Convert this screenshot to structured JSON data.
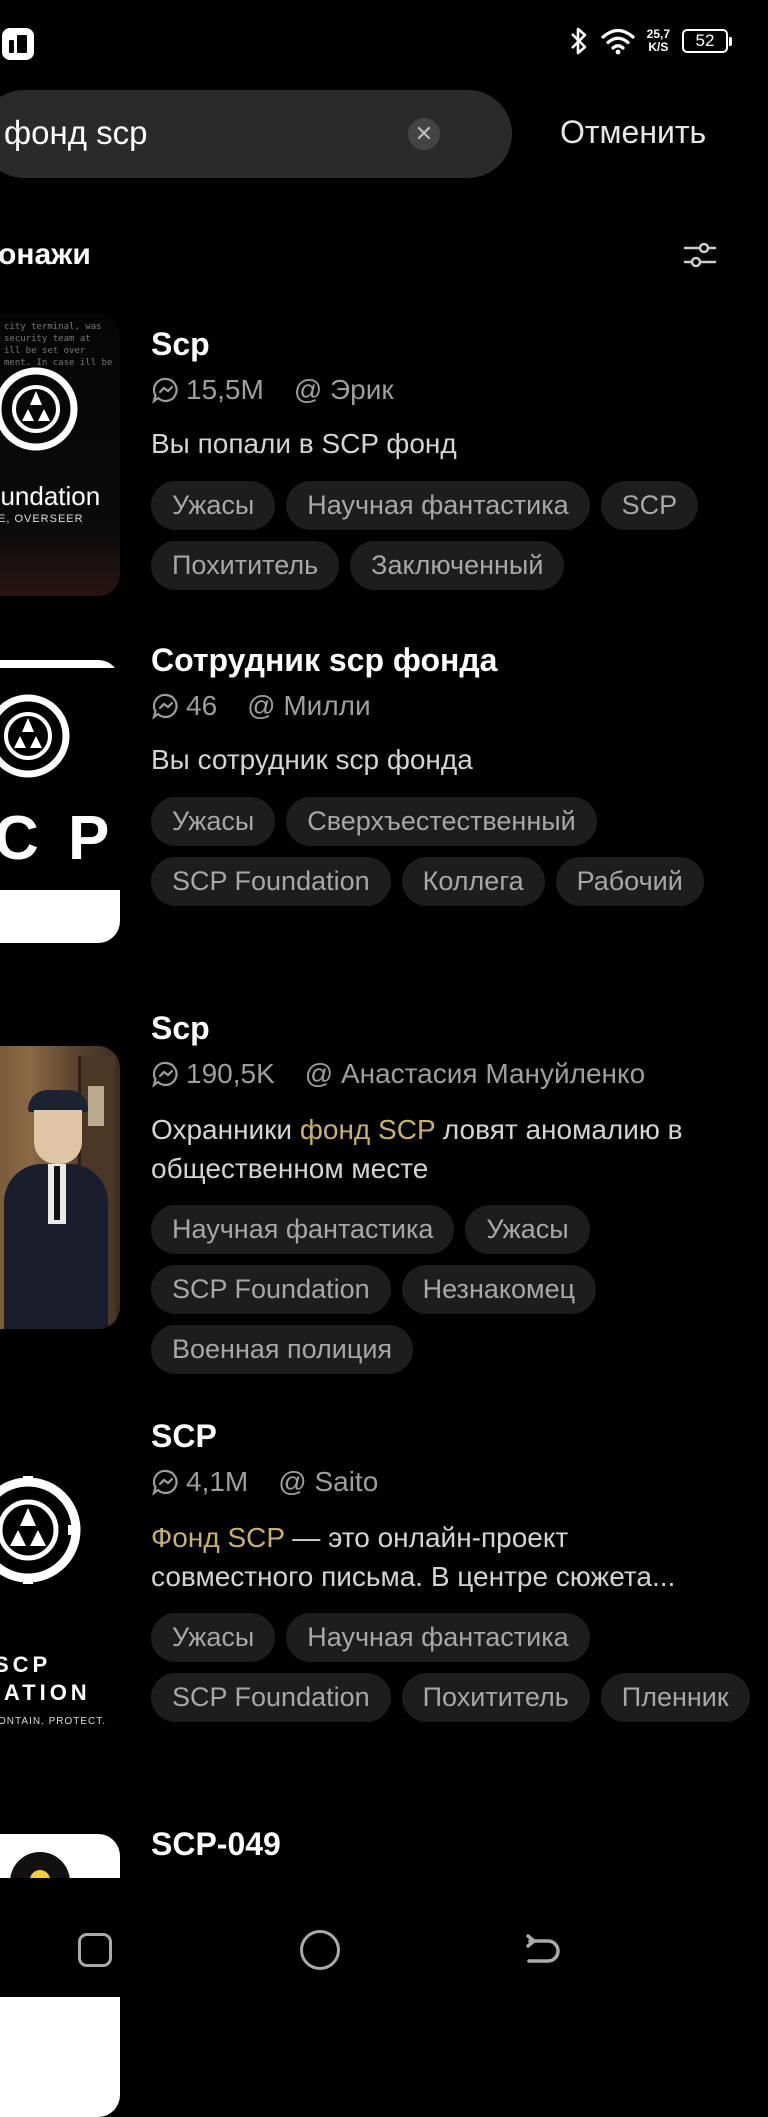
{
  "status_bar": {
    "net_speed_value": "25,7",
    "net_speed_unit": "K/S",
    "battery": "52"
  },
  "search": {
    "query": "фонд scp",
    "cancel_label": "Отменить"
  },
  "section": {
    "title": "онажи"
  },
  "results": [
    {
      "title": "Scp",
      "chats": "15,5M",
      "author": "@ Эрик",
      "description": "Вы попали в SCP фонд",
      "tags": [
        "Ужасы",
        "Научная фантастика",
        "SCP",
        "Похититель",
        "Заключенный"
      ],
      "thumb_text": [
        "oundation",
        "E, OVERSEER"
      ]
    },
    {
      "title": "Сотрудник scp фонда",
      "chats": "46",
      "author": "@ Милли",
      "description": "Вы сотрудник scp фонда",
      "tags": [
        "Ужасы",
        "Сверхъестественный",
        "SCP Foundation",
        "Коллега",
        "Рабочий"
      ],
      "thumb_text": [
        "C P"
      ]
    },
    {
      "title": "Scp",
      "chats": "190,5K",
      "author": "@ Анастасия Мануйленко",
      "description_pre": "Охранники ",
      "description_hl": "фонд SCP",
      "description_post": " ловят аномалию в общественном месте",
      "tags": [
        "Научная фантастика",
        "Ужасы",
        "SCP Foundation",
        "Незнакомец",
        "Военная полиция"
      ]
    },
    {
      "title": "SCP",
      "chats": "4,1M",
      "author": "@ Saito",
      "description_hl": "Фонд SCP",
      "description_post": " — это онлайн-проект совместного письма. В центре сюжета...",
      "tags": [
        "Ужасы",
        "Научная фантастика",
        "SCP Foundation",
        "Похититель",
        "Пленник"
      ],
      "thumb_text": [
        "SCP",
        "DATION",
        "ONTAIN. PROTECT."
      ]
    },
    {
      "title": "SCP-049"
    }
  ]
}
